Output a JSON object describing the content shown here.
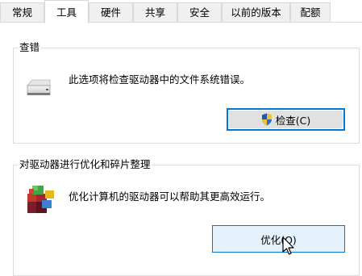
{
  "tabs": [
    {
      "label": "常规"
    },
    {
      "label": "工具",
      "active": true
    },
    {
      "label": "硬件"
    },
    {
      "label": "共享"
    },
    {
      "label": "安全"
    },
    {
      "label": "以前的版本"
    },
    {
      "label": "配额"
    }
  ],
  "error_check": {
    "title": "查错",
    "description": "此选项将检查驱动器中的文件系统错误。",
    "button_label": "检查(C)",
    "icons": {
      "drive": "hard-drive-icon",
      "button": "uac-shield-icon"
    }
  },
  "optimize": {
    "title": "对驱动器进行优化和碎片整理",
    "description": "优化计算机的驱动器可以帮助其更高效运行。",
    "button_label": "优化(O)",
    "icons": {
      "main": "defragment-icon"
    }
  },
  "colors": {
    "accent": "#0078d7",
    "tab_inactive_bg": "#f0f0f0",
    "button_bg": "#e1e1e1"
  }
}
